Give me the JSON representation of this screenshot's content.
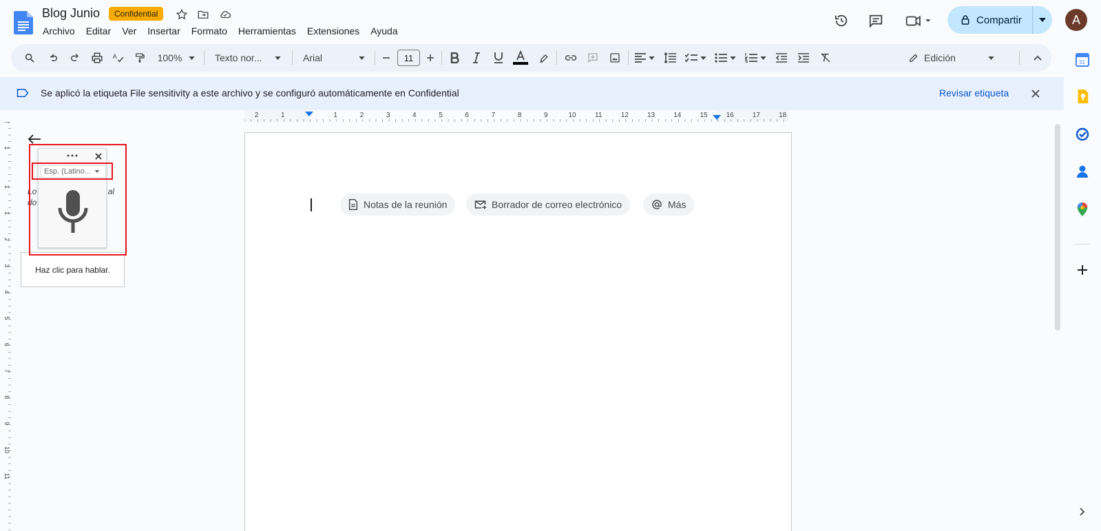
{
  "doc": {
    "title": "Blog Junio",
    "badge": "Confidential"
  },
  "menu": [
    "Archivo",
    "Editar",
    "Ver",
    "Insertar",
    "Formato",
    "Herramientas",
    "Extensiones",
    "Ayuda"
  ],
  "share": {
    "label": "Compartir"
  },
  "avatar": {
    "letter": "A"
  },
  "toolbar": {
    "zoom": "100%",
    "style": "Texto nor...",
    "font": "Arial",
    "font_size": "11",
    "mode": "Edición"
  },
  "banner": {
    "text": "Se aplicó la etiqueta File sensitivity a este archivo y se configuró automáticamente en Confidential",
    "link": "Revisar etiqueta"
  },
  "ruler": {
    "labels": [
      "2",
      "1",
      "1",
      "2",
      "3",
      "4",
      "5",
      "6",
      "7",
      "8",
      "9",
      "10",
      "11",
      "12",
      "13",
      "14",
      "15",
      "16",
      "17",
      "18"
    ],
    "vlabels": [
      "2",
      "1",
      "1",
      "1",
      "2",
      "3",
      "4",
      "5",
      "6",
      "7",
      "8",
      "9",
      "10",
      "11"
    ]
  },
  "chips": [
    {
      "label": "Notas de la reunión",
      "icon": "document-icon"
    },
    {
      "label": "Borrador de correo electrónico",
      "icon": "email-draft-icon"
    },
    {
      "label": "Más",
      "icon": "at-icon"
    }
  ],
  "outline": {
    "hint_line1": "Lo          ue agregues al",
    "hint_line2": "do          rarán aquí."
  },
  "voice": {
    "language": "Esp. (Latino...",
    "tooltip": "Haz clic para hablar."
  },
  "colors": {
    "accent": "#0b57d0",
    "badge": "#f9ab00",
    "share_bg": "#c2e7ff",
    "highlight_box": "#e5141a"
  }
}
